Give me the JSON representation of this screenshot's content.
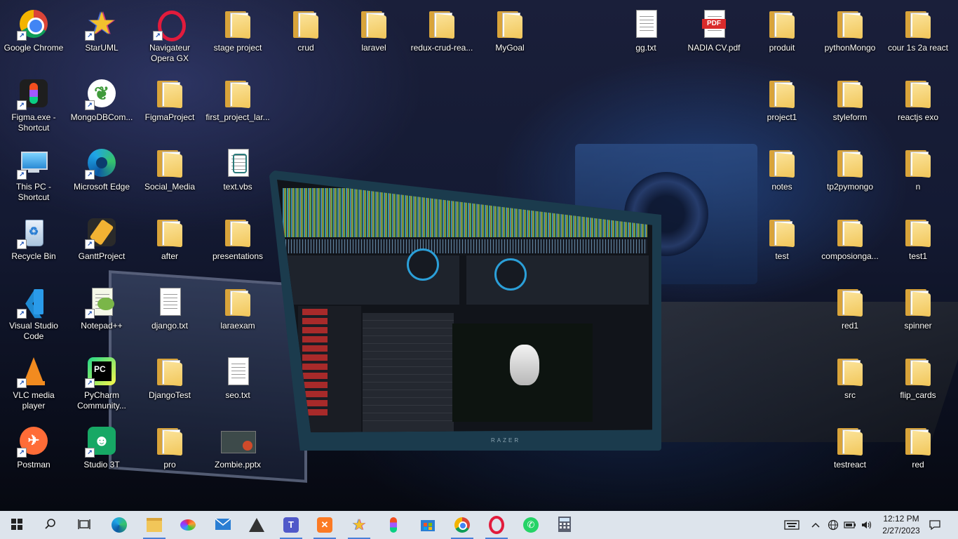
{
  "desktop": {
    "icons": [
      {
        "label": "Google Chrome",
        "icon": "chrome-icon"
      },
      {
        "label": "StarUML",
        "icon": "staruml-icon"
      },
      {
        "label": "Navigateur Opera GX",
        "icon": "opera-gx-icon"
      },
      {
        "label": "stage project",
        "icon": "folder-icon"
      },
      {
        "label": "crud",
        "icon": "folder-icon"
      },
      {
        "label": "laravel",
        "icon": "folder-icon"
      },
      {
        "label": "redux-crud-rea...",
        "icon": "folder-icon"
      },
      {
        "label": "MyGoal",
        "icon": "folder-icon"
      },
      {
        "label": "gg.txt",
        "icon": "text-file-icon"
      },
      {
        "label": "NADIA CV.pdf",
        "icon": "pdf-icon"
      },
      {
        "label": "produit",
        "icon": "folder-icon"
      },
      {
        "label": "pythonMongo",
        "icon": "folder-icon"
      },
      {
        "label": "cour 1s 2a react",
        "icon": "folder-icon"
      },
      {
        "label": "Figma.exe - Shortcut",
        "icon": "figma-icon"
      },
      {
        "label": "MongoDBCom...",
        "icon": "mongodb-icon"
      },
      {
        "label": "FigmaProject",
        "icon": "folder-icon"
      },
      {
        "label": "first_project_lar...",
        "icon": "folder-icon"
      },
      {
        "label": "project1",
        "icon": "folder-icon"
      },
      {
        "label": "styleform",
        "icon": "folder-icon"
      },
      {
        "label": "reactjs exo",
        "icon": "folder-icon"
      },
      {
        "label": "This PC - Shortcut",
        "icon": "this-pc-icon"
      },
      {
        "label": "Microsoft Edge",
        "icon": "edge-icon"
      },
      {
        "label": "Social_Media",
        "icon": "folder-icon"
      },
      {
        "label": "text.vbs",
        "icon": "vbs-script-icon"
      },
      {
        "label": "notes",
        "icon": "folder-icon"
      },
      {
        "label": "tp2pymongo",
        "icon": "folder-icon"
      },
      {
        "label": "n",
        "icon": "folder-icon"
      },
      {
        "label": "Recycle Bin",
        "icon": "recycle-bin-icon"
      },
      {
        "label": "GanttProject",
        "icon": "ganttproject-icon"
      },
      {
        "label": "after",
        "icon": "folder-icon"
      },
      {
        "label": "presentations",
        "icon": "folder-icon"
      },
      {
        "label": "test",
        "icon": "folder-icon"
      },
      {
        "label": "composionga...",
        "icon": "folder-icon"
      },
      {
        "label": "test1",
        "icon": "folder-icon"
      },
      {
        "label": "Visual Studio Code",
        "icon": "vscode-icon"
      },
      {
        "label": "Notepad++",
        "icon": "notepadpp-icon"
      },
      {
        "label": "django.txt",
        "icon": "text-file-icon"
      },
      {
        "label": "laraexam",
        "icon": "folder-icon"
      },
      {
        "label": "red1",
        "icon": "folder-icon"
      },
      {
        "label": "spinner",
        "icon": "folder-icon"
      },
      {
        "label": "VLC media player",
        "icon": "vlc-icon"
      },
      {
        "label": "PyCharm Community...",
        "icon": "pycharm-icon"
      },
      {
        "label": "DjangoTest",
        "icon": "folder-icon"
      },
      {
        "label": "seo.txt",
        "icon": "text-file-icon"
      },
      {
        "label": "src",
        "icon": "folder-icon"
      },
      {
        "label": "flip_cards",
        "icon": "folder-icon"
      },
      {
        "label": "Postman",
        "icon": "postman-icon"
      },
      {
        "label": "Studio 3T",
        "icon": "studio3t-icon"
      },
      {
        "label": "pro",
        "icon": "folder-icon"
      },
      {
        "label": "Zombie.pptx",
        "icon": "pptx-icon"
      },
      {
        "label": "testreact",
        "icon": "folder-icon"
      },
      {
        "label": "red",
        "icon": "folder-icon"
      }
    ]
  },
  "taskbar": {
    "apps": [
      {
        "icon": "windows-start-icon"
      },
      {
        "icon": "search-icon"
      },
      {
        "icon": "task-view-icon"
      },
      {
        "icon": "edge-icon"
      },
      {
        "icon": "file-explorer-icon"
      },
      {
        "icon": "paint-icon"
      },
      {
        "icon": "mail-icon"
      },
      {
        "icon": "inkscape-icon"
      },
      {
        "icon": "teams-icon"
      },
      {
        "icon": "xampp-icon"
      },
      {
        "icon": "staruml-icon"
      },
      {
        "icon": "figma-icon"
      },
      {
        "icon": "microsoft-store-icon"
      },
      {
        "icon": "chrome-icon"
      },
      {
        "icon": "opera-icon"
      },
      {
        "icon": "whatsapp-icon"
      },
      {
        "icon": "calculator-icon"
      }
    ],
    "tray": {
      "time": "12:12 PM",
      "date": "2/27/2023"
    }
  },
  "wallpaper": {
    "laptop_brand": "RAZER"
  }
}
